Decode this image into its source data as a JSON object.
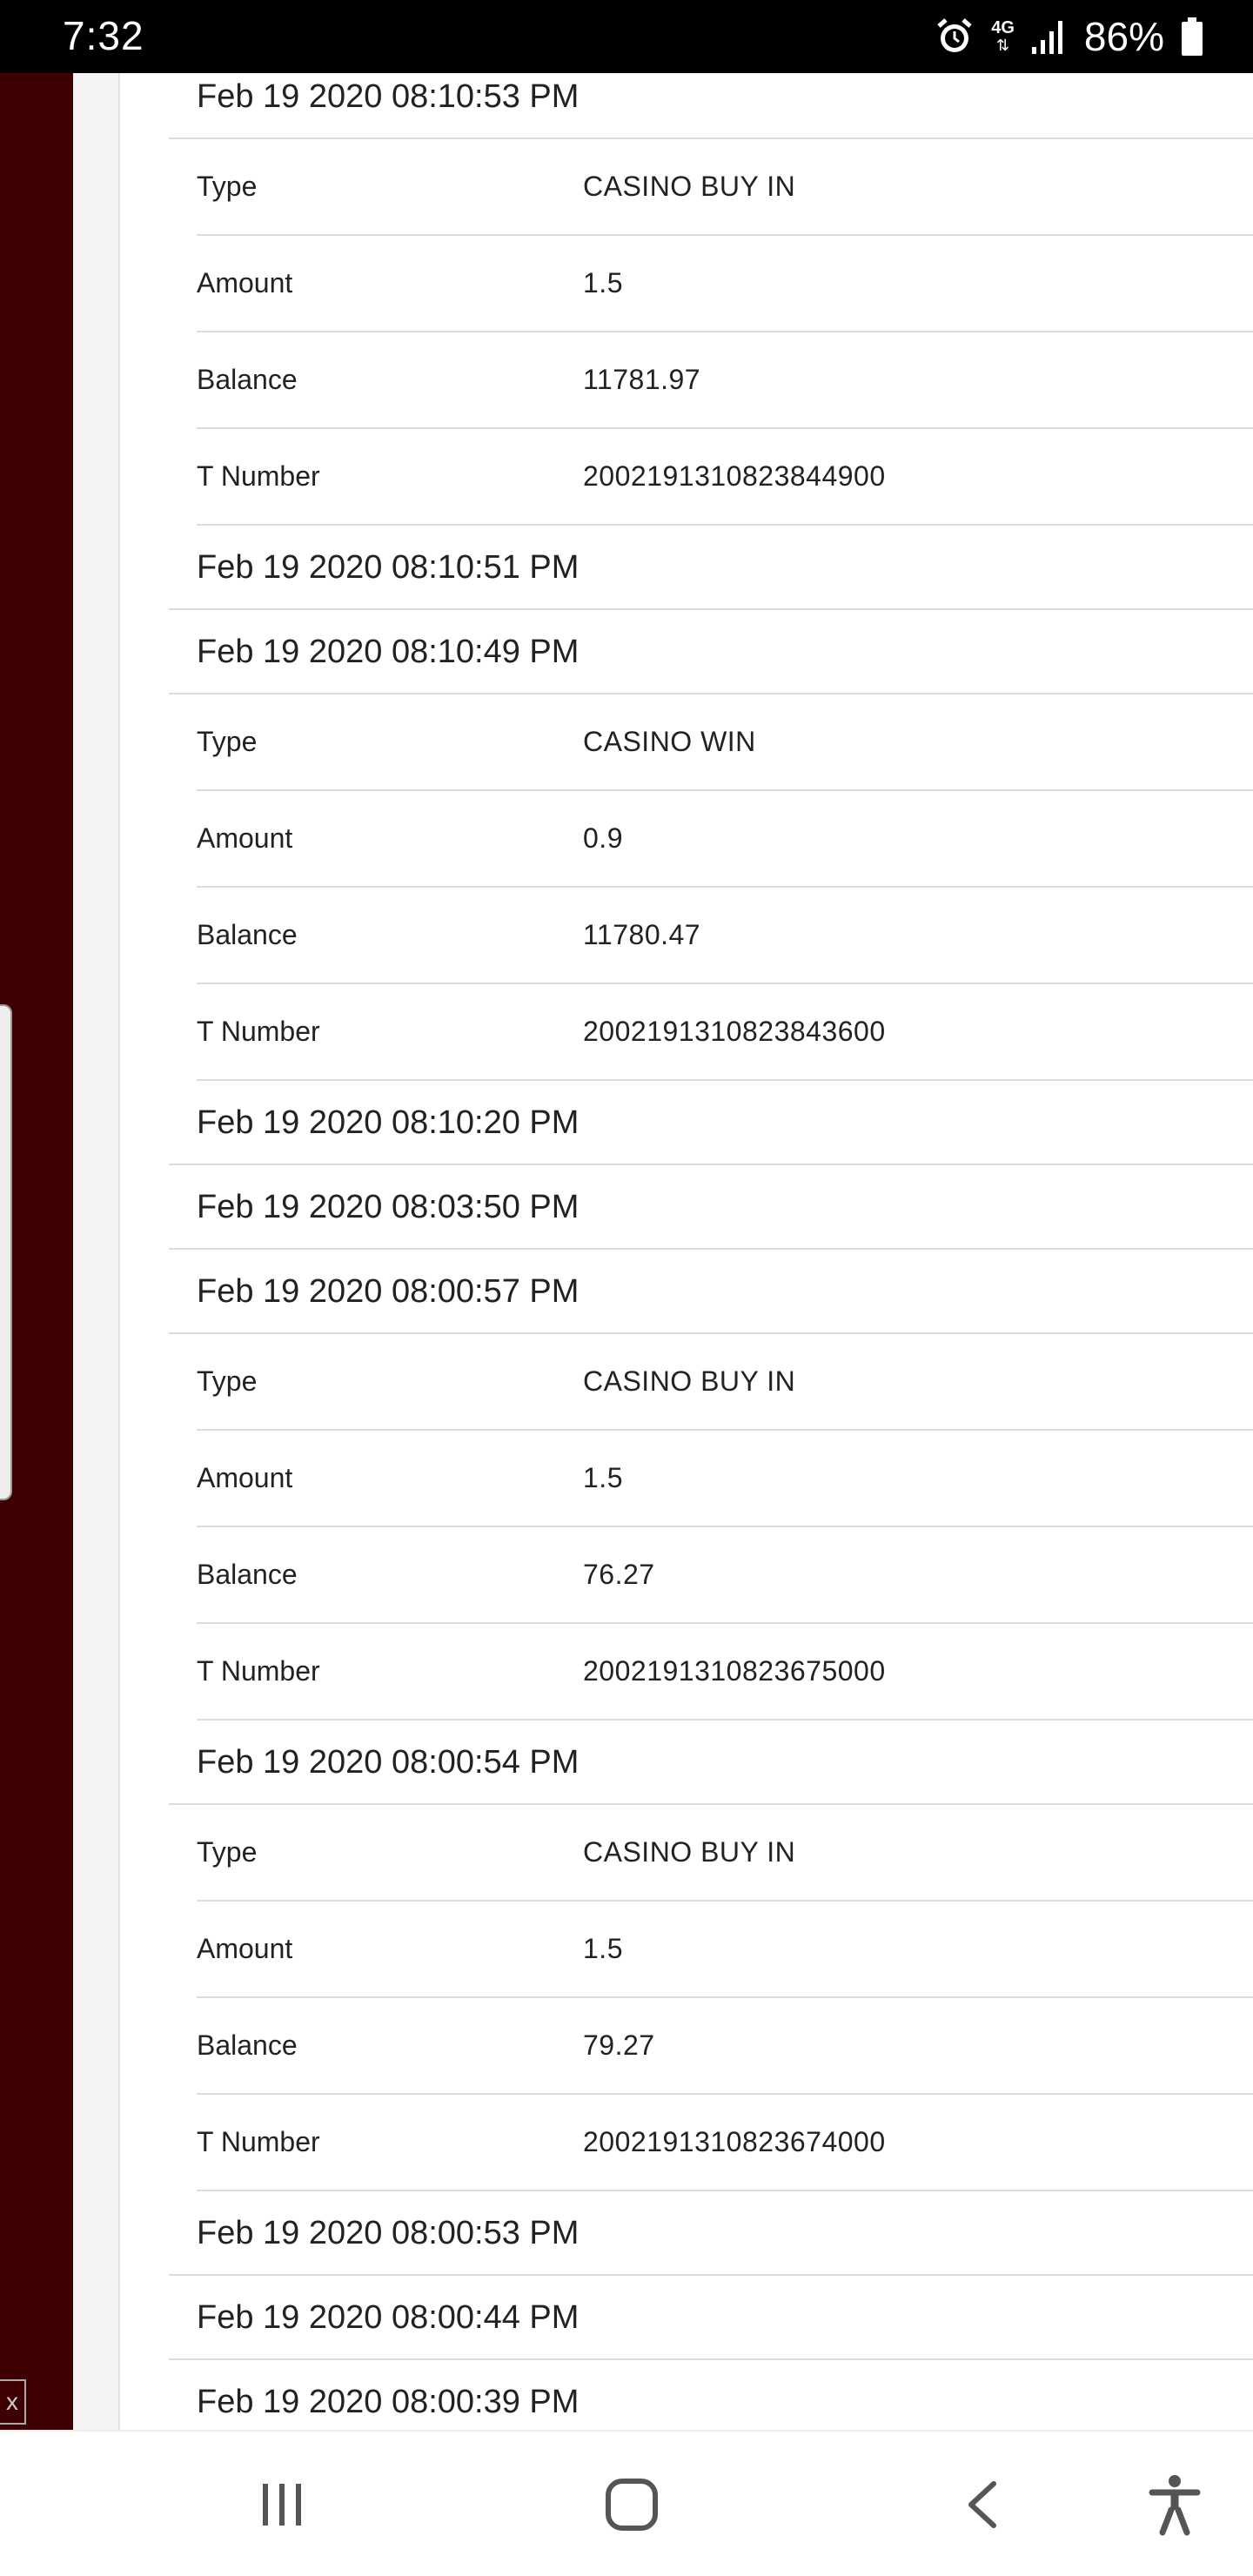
{
  "status_bar": {
    "time": "7:32",
    "network": "4G",
    "battery": "86%",
    "icons": [
      "alarm-icon",
      "network-4g-icon",
      "signal-icon",
      "battery-icon"
    ]
  },
  "labels": {
    "type": "Type",
    "amount": "Amount",
    "balance": "Balance",
    "t_number": "T Number"
  },
  "transactions": [
    {
      "date": "Feb 19 2020 08:10:53 PM",
      "expanded": true,
      "type": "CASINO BUY IN",
      "amount": "1.5",
      "balance": "11781.97",
      "t_number": "2002191310823844900"
    },
    {
      "date": "Feb 19 2020 08:10:51 PM",
      "expanded": false
    },
    {
      "date": "Feb 19 2020 08:10:49 PM",
      "expanded": true,
      "type": "CASINO WIN",
      "amount": "0.9",
      "balance": "11780.47",
      "t_number": "2002191310823843600"
    },
    {
      "date": "Feb 19 2020 08:10:20 PM",
      "expanded": false
    },
    {
      "date": "Feb 19 2020 08:03:50 PM",
      "expanded": false
    },
    {
      "date": "Feb 19 2020 08:00:57 PM",
      "expanded": true,
      "type": "CASINO BUY IN",
      "amount": "1.5",
      "balance": "76.27",
      "t_number": "2002191310823675000"
    },
    {
      "date": "Feb 19 2020 08:00:54 PM",
      "expanded": true,
      "type": "CASINO BUY IN",
      "amount": "1.5",
      "balance": "79.27",
      "t_number": "2002191310823674000"
    },
    {
      "date": "Feb 19 2020 08:00:53 PM",
      "expanded": false
    },
    {
      "date": "Feb 19 2020 08:00:44 PM",
      "expanded": false
    },
    {
      "date": "Feb 19 2020 08:00:39 PM",
      "expanded": false
    }
  ],
  "side_panel": {
    "color": "#3f0004",
    "close_glyph": "x"
  },
  "nav_bar": {
    "buttons": [
      "recent-apps-icon",
      "home-icon",
      "back-icon",
      "accessibility-icon"
    ]
  }
}
